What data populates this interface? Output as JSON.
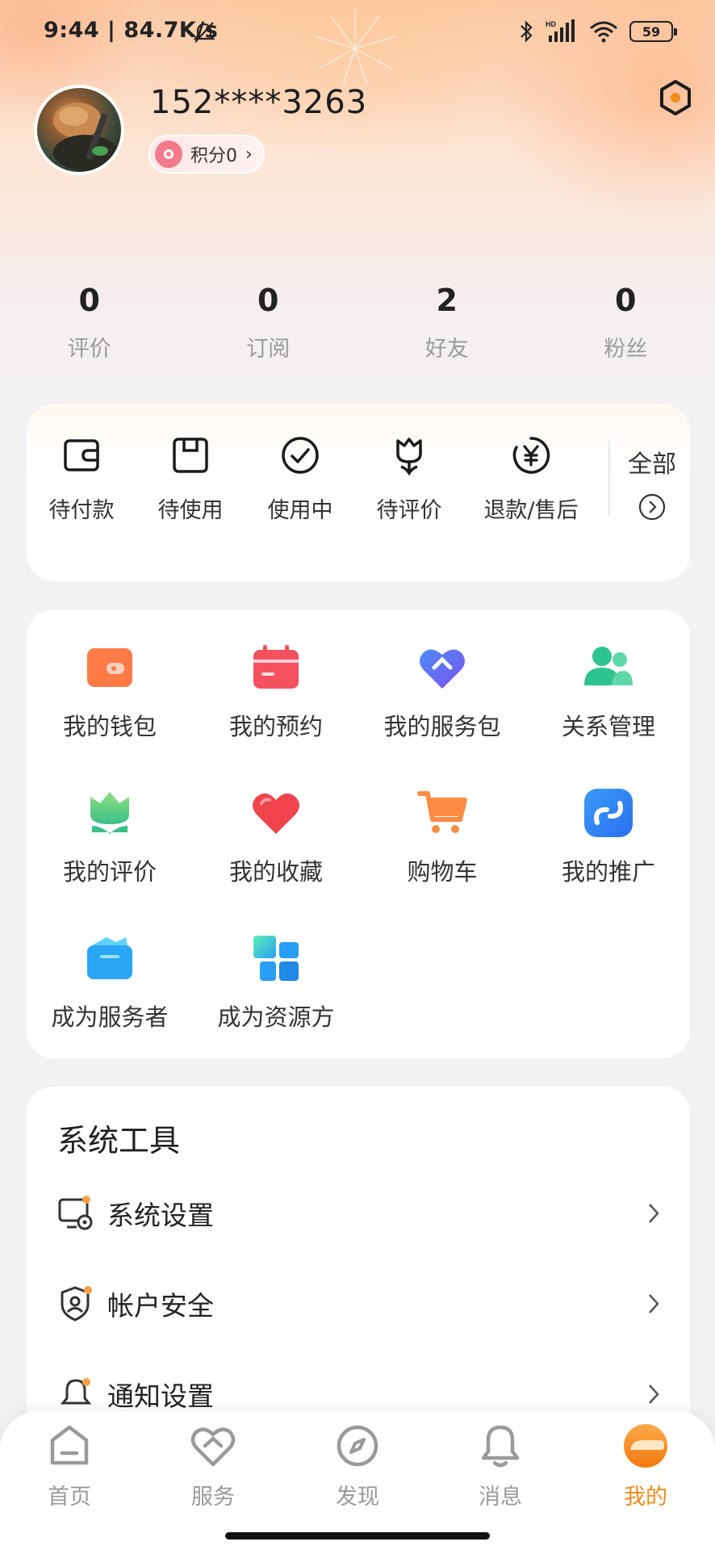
{
  "status_bar": {
    "time": "9:44 | 84.7K/s",
    "battery": "59",
    "hd_label": "HD"
  },
  "profile": {
    "username": "152****3263",
    "points_label": "积分0",
    "points_chevron": "›"
  },
  "stats": [
    {
      "value": "0",
      "label": "评价"
    },
    {
      "value": "0",
      "label": "订阅"
    },
    {
      "value": "2",
      "label": "好友"
    },
    {
      "value": "0",
      "label": "粉丝"
    }
  ],
  "orders": {
    "items": [
      {
        "label": "待付款",
        "icon": "wallet-outline-icon"
      },
      {
        "label": "待使用",
        "icon": "bag-outline-icon"
      },
      {
        "label": "使用中",
        "icon": "check-circle-icon"
      },
      {
        "label": "待评价",
        "icon": "tulip-outline-icon"
      },
      {
        "label": "退款/售后",
        "icon": "yen-circle-icon"
      }
    ],
    "all_label": "全部"
  },
  "services": [
    {
      "label": "我的钱包",
      "icon": "wallet-icon",
      "color": "#ff7a45"
    },
    {
      "label": "我的预约",
      "icon": "calendar-icon",
      "color": "#f5515f"
    },
    {
      "label": "我的服务包",
      "icon": "service-heart-icon",
      "color": "#5b6cf0"
    },
    {
      "label": "关系管理",
      "icon": "people-icon",
      "color": "#2ec48f"
    },
    {
      "label": "我的评价",
      "icon": "tulip-icon",
      "color": "#6cd26b"
    },
    {
      "label": "我的收藏",
      "icon": "heart-icon",
      "color": "#f0444c"
    },
    {
      "label": "购物车",
      "icon": "cart-icon",
      "color": "#ff8c42"
    },
    {
      "label": "我的推广",
      "icon": "share-link-icon",
      "color": "#2f8bf5"
    },
    {
      "label": "成为服务者",
      "icon": "folder-icon",
      "color": "#29a6f5"
    },
    {
      "label": "成为资源方",
      "icon": "grid-blocks-icon",
      "color": "#2a9df4"
    }
  ],
  "tools": {
    "title": "系统工具",
    "items": [
      {
        "label": "系统设置",
        "icon": "monitor-gear-icon"
      },
      {
        "label": "帐户安全",
        "icon": "shield-user-icon"
      },
      {
        "label": "通知设置",
        "icon": "bell-icon"
      }
    ]
  },
  "tabbar": [
    {
      "label": "首页",
      "icon": "home-icon",
      "active": false
    },
    {
      "label": "服务",
      "icon": "service-heart-outline-icon",
      "active": false
    },
    {
      "label": "发现",
      "icon": "compass-icon",
      "active": false
    },
    {
      "label": "消息",
      "icon": "chat-bell-icon",
      "active": false
    },
    {
      "label": "我的",
      "icon": "profile-orange-icon",
      "active": true
    }
  ],
  "colors": {
    "accent": "#f08a1a",
    "inactive": "#9a9a9a"
  }
}
